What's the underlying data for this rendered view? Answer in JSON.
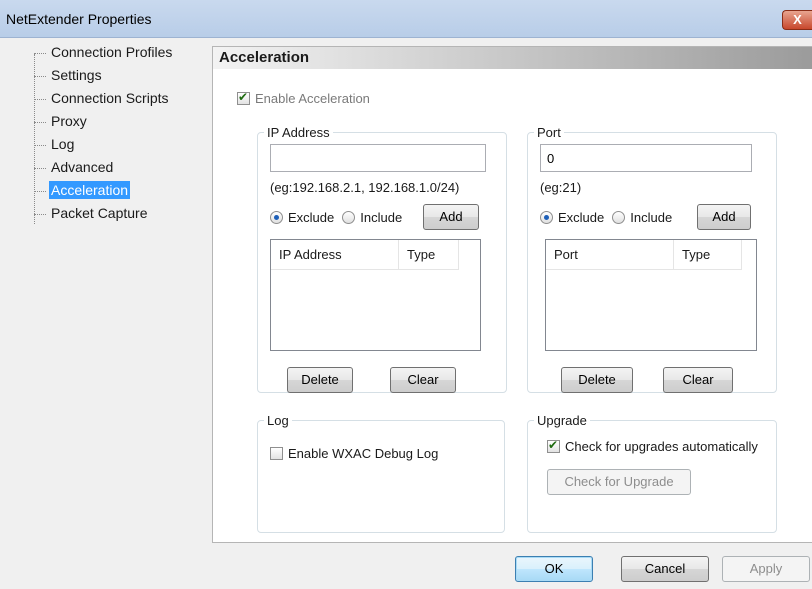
{
  "window": {
    "title": "NetExtender Properties",
    "close_glyph": "X"
  },
  "tree": {
    "items": [
      {
        "label": "Connection Profiles",
        "selected": false
      },
      {
        "label": "Settings",
        "selected": false
      },
      {
        "label": "Connection Scripts",
        "selected": false
      },
      {
        "label": "Proxy",
        "selected": false
      },
      {
        "label": "Log",
        "selected": false
      },
      {
        "label": "Advanced",
        "selected": false
      },
      {
        "label": "Acceleration",
        "selected": true
      },
      {
        "label": "Packet Capture",
        "selected": false
      }
    ]
  },
  "panel": {
    "title": "Acceleration",
    "enable_acceleration": {
      "label": "Enable Acceleration",
      "checked": true,
      "enabled": false
    },
    "ip_group": {
      "legend": "IP Address",
      "input_value": "",
      "hint": "(eg:192.168.2.1, 192.168.1.0/24)",
      "exclude_label": "Exclude",
      "include_label": "Include",
      "selected": "Exclude",
      "add_label": "Add",
      "columns": [
        "IP Address",
        "Type"
      ],
      "rows": [],
      "delete_label": "Delete",
      "clear_label": "Clear"
    },
    "port_group": {
      "legend": "Port",
      "input_value": "0",
      "hint": "(eg:21)",
      "exclude_label": "Exclude",
      "include_label": "Include",
      "selected": "Exclude",
      "add_label": "Add",
      "columns": [
        "Port",
        "Type"
      ],
      "rows": [],
      "delete_label": "Delete",
      "clear_label": "Clear"
    },
    "log_group": {
      "legend": "Log",
      "debug_label": "Enable WXAC Debug Log",
      "debug_checked": false
    },
    "upgrade_group": {
      "legend": "Upgrade",
      "auto_label": "Check for upgrades automatically",
      "auto_checked": true,
      "check_button": "Check for Upgrade"
    }
  },
  "footer": {
    "ok": "OK",
    "cancel": "Cancel",
    "apply": "Apply"
  }
}
